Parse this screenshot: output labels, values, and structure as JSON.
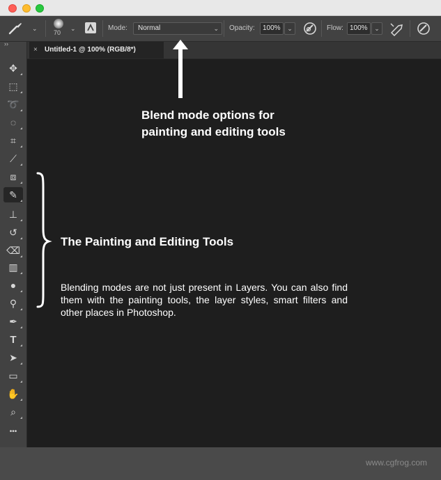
{
  "window": {
    "tab_close": "×",
    "document_tab": "Untitled-1 @ 100% (RGB/8*)"
  },
  "options_bar": {
    "brush_size": "70",
    "mode_label": "Mode:",
    "mode_value": "Normal",
    "opacity_label": "Opacity:",
    "opacity_value": "100%",
    "flow_label": "Flow:",
    "flow_value": "100%"
  },
  "toolbar": {
    "collapse": "››",
    "tools": [
      {
        "name": "move-tool",
        "icon": "move-icon"
      },
      {
        "name": "marquee-tool",
        "icon": "marquee-icon"
      },
      {
        "name": "lasso-tool",
        "icon": "lasso-icon"
      },
      {
        "name": "quick-selection-tool",
        "icon": "quick-selection-icon"
      },
      {
        "name": "crop-tool",
        "icon": "crop-icon"
      },
      {
        "name": "eyedropper-tool",
        "icon": "eyedropper-icon"
      },
      {
        "name": "healing-brush-tool",
        "icon": "healing-icon"
      },
      {
        "name": "brush-tool",
        "icon": "brush-icon",
        "active": true
      },
      {
        "name": "clone-stamp-tool",
        "icon": "stamp-icon"
      },
      {
        "name": "history-brush-tool",
        "icon": "history-brush-icon"
      },
      {
        "name": "eraser-tool",
        "icon": "eraser-icon"
      },
      {
        "name": "gradient-tool",
        "icon": "gradient-icon"
      },
      {
        "name": "blur-tool",
        "icon": "blur-icon"
      },
      {
        "name": "dodge-tool",
        "icon": "dodge-icon"
      },
      {
        "name": "pen-tool",
        "icon": "pen-icon"
      },
      {
        "name": "type-tool",
        "icon": "type-icon",
        "text": "T"
      },
      {
        "name": "path-selection-tool",
        "icon": "arrow-icon"
      },
      {
        "name": "rectangle-tool",
        "icon": "rectangle-icon"
      },
      {
        "name": "hand-tool",
        "icon": "hand-icon"
      },
      {
        "name": "zoom-tool",
        "icon": "zoom-icon"
      },
      {
        "name": "more-tools",
        "icon": "ellipsis-icon",
        "text": "•••"
      }
    ]
  },
  "annotations": {
    "blend_line1": "Blend mode options for",
    "blend_line2": "painting and editing tools",
    "section_title": "The Painting and Editing Tools",
    "body": "Blending modes are not just present in Layers. You can also find them with the painting tools, the layer styles, smart filters and other places in Photoshop."
  },
  "watermark": "www.cgfrog.com",
  "colors": {
    "canvas": "#1e1e1e",
    "panel": "#424242",
    "annotation_text": "#ffffff"
  }
}
